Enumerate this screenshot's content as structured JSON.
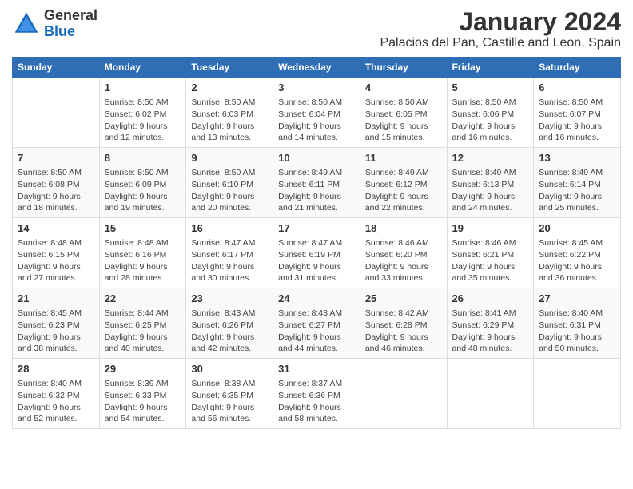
{
  "logo": {
    "general": "General",
    "blue": "Blue"
  },
  "title": "January 2024",
  "subtitle": "Palacios del Pan, Castille and Leon, Spain",
  "calendar": {
    "headers": [
      "Sunday",
      "Monday",
      "Tuesday",
      "Wednesday",
      "Thursday",
      "Friday",
      "Saturday"
    ],
    "rows": [
      [
        {
          "day": "",
          "info": ""
        },
        {
          "day": "1",
          "info": "Sunrise: 8:50 AM\nSunset: 6:02 PM\nDaylight: 9 hours\nand 12 minutes."
        },
        {
          "day": "2",
          "info": "Sunrise: 8:50 AM\nSunset: 6:03 PM\nDaylight: 9 hours\nand 13 minutes."
        },
        {
          "day": "3",
          "info": "Sunrise: 8:50 AM\nSunset: 6:04 PM\nDaylight: 9 hours\nand 14 minutes."
        },
        {
          "day": "4",
          "info": "Sunrise: 8:50 AM\nSunset: 6:05 PM\nDaylight: 9 hours\nand 15 minutes."
        },
        {
          "day": "5",
          "info": "Sunrise: 8:50 AM\nSunset: 6:06 PM\nDaylight: 9 hours\nand 16 minutes."
        },
        {
          "day": "6",
          "info": "Sunrise: 8:50 AM\nSunset: 6:07 PM\nDaylight: 9 hours\nand 16 minutes."
        }
      ],
      [
        {
          "day": "7",
          "info": "Sunrise: 8:50 AM\nSunset: 6:08 PM\nDaylight: 9 hours\nand 18 minutes."
        },
        {
          "day": "8",
          "info": "Sunrise: 8:50 AM\nSunset: 6:09 PM\nDaylight: 9 hours\nand 19 minutes."
        },
        {
          "day": "9",
          "info": "Sunrise: 8:50 AM\nSunset: 6:10 PM\nDaylight: 9 hours\nand 20 minutes."
        },
        {
          "day": "10",
          "info": "Sunrise: 8:49 AM\nSunset: 6:11 PM\nDaylight: 9 hours\nand 21 minutes."
        },
        {
          "day": "11",
          "info": "Sunrise: 8:49 AM\nSunset: 6:12 PM\nDaylight: 9 hours\nand 22 minutes."
        },
        {
          "day": "12",
          "info": "Sunrise: 8:49 AM\nSunset: 6:13 PM\nDaylight: 9 hours\nand 24 minutes."
        },
        {
          "day": "13",
          "info": "Sunrise: 8:49 AM\nSunset: 6:14 PM\nDaylight: 9 hours\nand 25 minutes."
        }
      ],
      [
        {
          "day": "14",
          "info": "Sunrise: 8:48 AM\nSunset: 6:15 PM\nDaylight: 9 hours\nand 27 minutes."
        },
        {
          "day": "15",
          "info": "Sunrise: 8:48 AM\nSunset: 6:16 PM\nDaylight: 9 hours\nand 28 minutes."
        },
        {
          "day": "16",
          "info": "Sunrise: 8:47 AM\nSunset: 6:17 PM\nDaylight: 9 hours\nand 30 minutes."
        },
        {
          "day": "17",
          "info": "Sunrise: 8:47 AM\nSunset: 6:19 PM\nDaylight: 9 hours\nand 31 minutes."
        },
        {
          "day": "18",
          "info": "Sunrise: 8:46 AM\nSunset: 6:20 PM\nDaylight: 9 hours\nand 33 minutes."
        },
        {
          "day": "19",
          "info": "Sunrise: 8:46 AM\nSunset: 6:21 PM\nDaylight: 9 hours\nand 35 minutes."
        },
        {
          "day": "20",
          "info": "Sunrise: 8:45 AM\nSunset: 6:22 PM\nDaylight: 9 hours\nand 36 minutes."
        }
      ],
      [
        {
          "day": "21",
          "info": "Sunrise: 8:45 AM\nSunset: 6:23 PM\nDaylight: 9 hours\nand 38 minutes."
        },
        {
          "day": "22",
          "info": "Sunrise: 8:44 AM\nSunset: 6:25 PM\nDaylight: 9 hours\nand 40 minutes."
        },
        {
          "day": "23",
          "info": "Sunrise: 8:43 AM\nSunset: 6:26 PM\nDaylight: 9 hours\nand 42 minutes."
        },
        {
          "day": "24",
          "info": "Sunrise: 8:43 AM\nSunset: 6:27 PM\nDaylight: 9 hours\nand 44 minutes."
        },
        {
          "day": "25",
          "info": "Sunrise: 8:42 AM\nSunset: 6:28 PM\nDaylight: 9 hours\nand 46 minutes."
        },
        {
          "day": "26",
          "info": "Sunrise: 8:41 AM\nSunset: 6:29 PM\nDaylight: 9 hours\nand 48 minutes."
        },
        {
          "day": "27",
          "info": "Sunrise: 8:40 AM\nSunset: 6:31 PM\nDaylight: 9 hours\nand 50 minutes."
        }
      ],
      [
        {
          "day": "28",
          "info": "Sunrise: 8:40 AM\nSunset: 6:32 PM\nDaylight: 9 hours\nand 52 minutes."
        },
        {
          "day": "29",
          "info": "Sunrise: 8:39 AM\nSunset: 6:33 PM\nDaylight: 9 hours\nand 54 minutes."
        },
        {
          "day": "30",
          "info": "Sunrise: 8:38 AM\nSunset: 6:35 PM\nDaylight: 9 hours\nand 56 minutes."
        },
        {
          "day": "31",
          "info": "Sunrise: 8:37 AM\nSunset: 6:36 PM\nDaylight: 9 hours\nand 58 minutes."
        },
        {
          "day": "",
          "info": ""
        },
        {
          "day": "",
          "info": ""
        },
        {
          "day": "",
          "info": ""
        }
      ]
    ]
  }
}
